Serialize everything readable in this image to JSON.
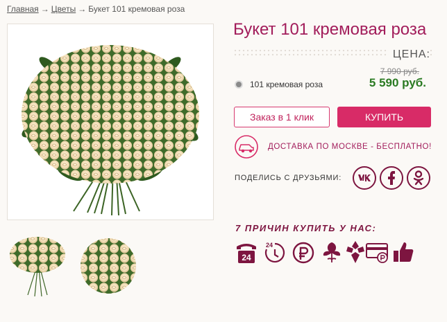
{
  "breadcrumb": {
    "items": [
      "Главная",
      "Цветы",
      "Букет 101 кремовая роза"
    ],
    "separator": "→"
  },
  "product": {
    "title": "Букет 101 кремовая роза",
    "price_label": "ЦЕНА:",
    "option_label": "101 кремовая роза",
    "old_price": "7 990 руб.",
    "new_price": "5 590 руб."
  },
  "actions": {
    "oneclick_label": "Заказ в 1 клик",
    "buy_label": "КУПИТЬ"
  },
  "delivery": {
    "text": "ДОСТАВКА ПО МОСКВЕ - БЕСПЛАТНО!",
    "icon": "car-icon"
  },
  "share": {
    "label": "ПОДЕЛИСЬ С ДРУЗЬЯМИ:",
    "networks": [
      "vk-icon",
      "facebook-icon",
      "odnoklassniki-icon"
    ]
  },
  "reasons": {
    "title": "7 ПРИЧИН КУПИТЬ У НАС:",
    "icons": [
      "phone-24-icon",
      "clock-24-icon",
      "ruble-icon",
      "flower-icon",
      "bouquet-icon",
      "card-payment-icon",
      "thumbs-up-icon"
    ]
  },
  "colors": {
    "brand": "#a21d5b",
    "button": "#d82b67",
    "price_green": "#2a7a22",
    "icon_dark": "#7d1540",
    "background": "#fbf9f6"
  }
}
